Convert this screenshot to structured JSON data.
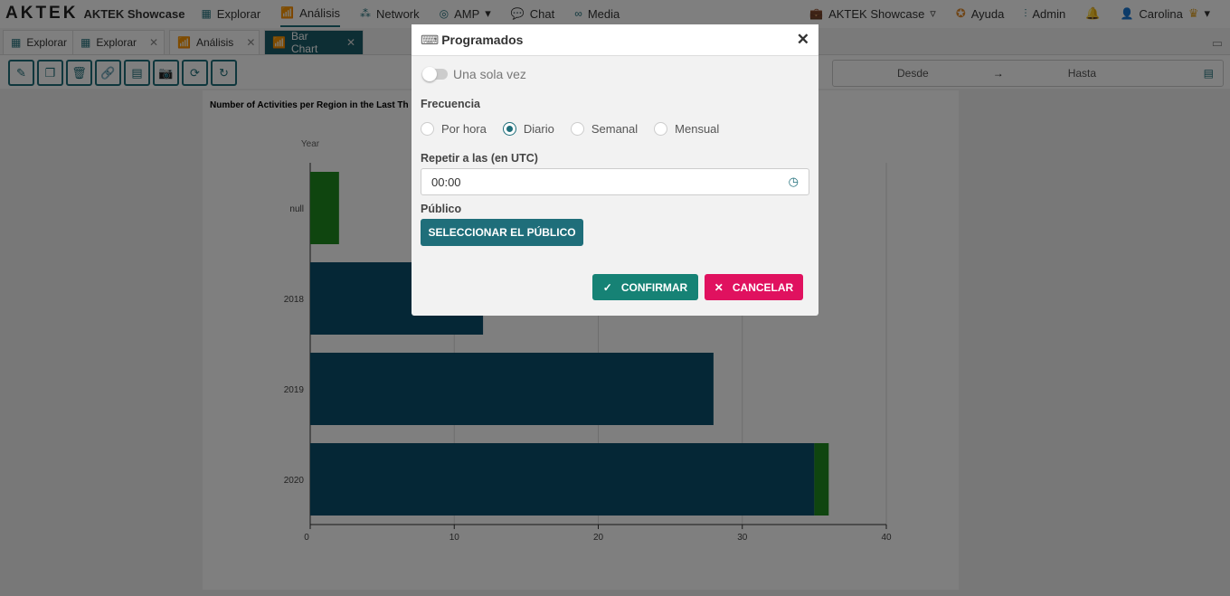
{
  "nav": {
    "logo": "AKTEK",
    "brand": "AKTEK Showcase",
    "items": [
      "Explorar",
      "Análisis",
      "Network",
      "AMP",
      "Chat",
      "Media"
    ],
    "workspace": "AKTEK Showcase",
    "help": "Ayuda",
    "admin": "Admin",
    "user": "Carolina"
  },
  "tabs": [
    {
      "label": "Explorar"
    },
    {
      "label": "Explorar"
    },
    {
      "label": "Análisis"
    },
    {
      "label": "Bar Chart"
    }
  ],
  "dates": {
    "from": "Desde",
    "arrow": "→",
    "to": "Hasta"
  },
  "chart_data": {
    "type": "bar",
    "orientation": "horizontal",
    "stacked": true,
    "title": "Number of Activities per Region in the Last Th",
    "ylabel": "Year",
    "categories": [
      "null",
      "2018",
      "2019",
      "2020"
    ],
    "series": [
      {
        "color": "#0b4f6c",
        "values": [
          0,
          12,
          28,
          35
        ]
      },
      {
        "color": "#1e8a1e",
        "values": [
          2,
          0,
          0,
          1
        ]
      }
    ],
    "xlim": [
      0,
      40
    ],
    "xticks": [
      "0",
      "10",
      "20",
      "30",
      "40"
    ],
    "grid": true
  },
  "modal": {
    "title": "Programados",
    "once": "Una sola vez",
    "freq_label": "Frecuencia",
    "freq_options": [
      "Por hora",
      "Diario",
      "Semanal",
      "Mensual"
    ],
    "freq_selected": "Diario",
    "repeat_label": "Repetir a las (en UTC)",
    "time": "00:00",
    "public_label": "Público",
    "select_public": "SELECCIONAR EL PÚBLICO",
    "confirm": "CONFIRMAR",
    "cancel": "CANCELAR"
  },
  "colors": {
    "accent": "#1f6e7a",
    "confirm": "#168275",
    "cancel": "#e0115f"
  }
}
